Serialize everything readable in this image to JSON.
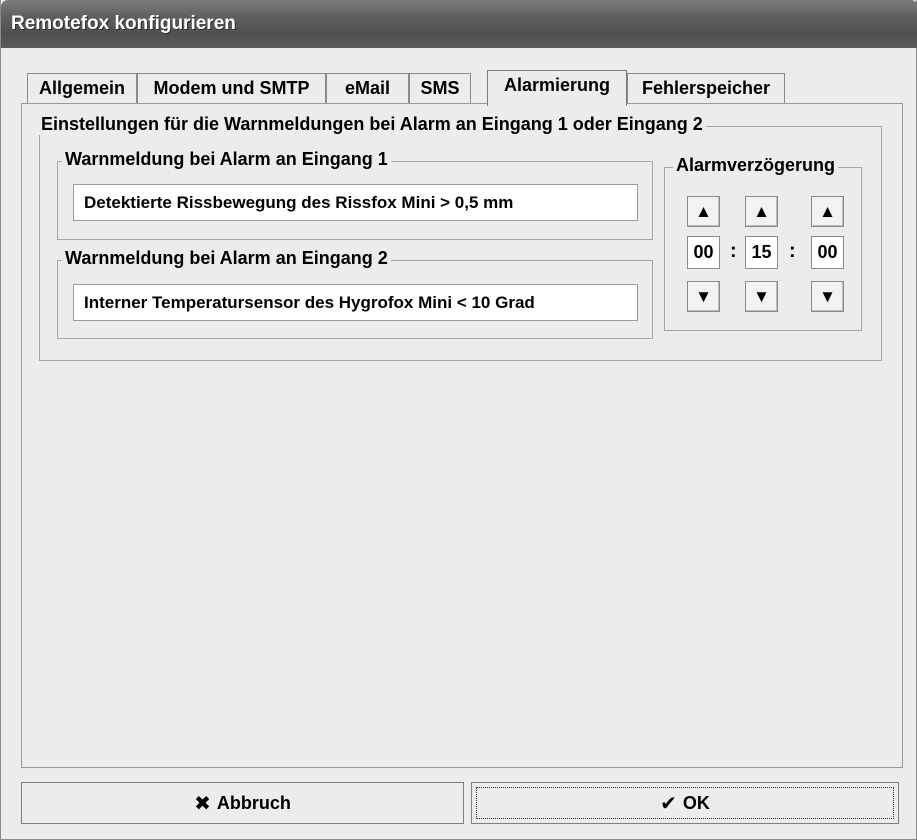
{
  "window": {
    "title": "Remotefox konfigurieren"
  },
  "tabs": [
    {
      "label": "Allgemein",
      "active": false
    },
    {
      "label": "Modem und SMTP",
      "active": false
    },
    {
      "label": "eMail",
      "active": false
    },
    {
      "label": "SMS",
      "active": false
    },
    {
      "label": "Alarmierung",
      "active": true
    },
    {
      "label": "Fehlerspeicher",
      "active": false
    }
  ],
  "settings": {
    "group_title": "Einstellungen für die Warnmeldungen bei Alarm an Eingang 1 oder Eingang 2",
    "input1": {
      "label": "Warnmeldung bei Alarm an Eingang 1",
      "value": "Detektierte Rissbewegung des Rissfox Mini > 0,5 mm"
    },
    "input2": {
      "label": "Warnmeldung bei Alarm an Eingang 2",
      "value": "Interner Temperatursensor des Hygrofox Mini < 10 Grad"
    },
    "delay": {
      "label": "Alarmverzögerung",
      "hours": "00",
      "minutes": "15",
      "seconds": "00",
      "separator": ":"
    }
  },
  "buttons": {
    "cancel": {
      "label": "Abbruch",
      "icon": "x-icon"
    },
    "ok": {
      "label": "OK",
      "icon": "checkmark-icon"
    }
  }
}
